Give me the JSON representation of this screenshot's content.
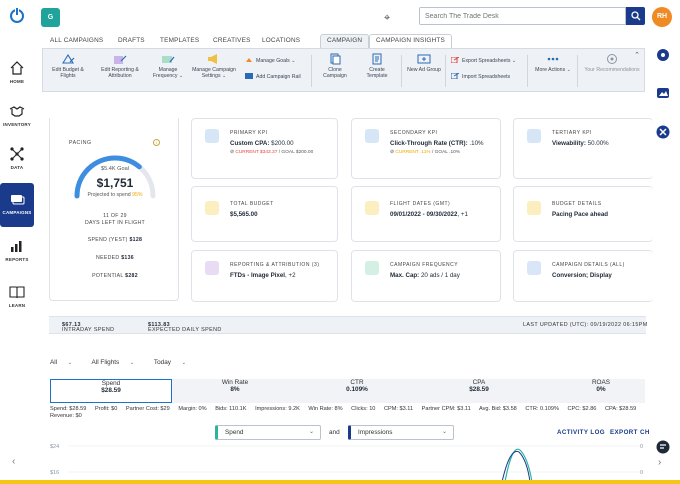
{
  "header": {
    "brand_initial": "G",
    "search_placeholder": "Search The Trade Desk",
    "avatar_initials": "RH"
  },
  "leftnav": {
    "items": [
      {
        "label": "HOME",
        "icon": "home-icon"
      },
      {
        "label": "INVENTORY",
        "icon": "handshake-icon"
      },
      {
        "label": "DATA",
        "icon": "network-icon"
      },
      {
        "label": "CAMPAIGNS",
        "icon": "campaigns-icon",
        "active": true
      },
      {
        "label": "REPORTS",
        "icon": "bar-chart-icon"
      },
      {
        "label": "LEARN",
        "icon": "book-icon"
      }
    ]
  },
  "tabs": [
    "ALL CAMPAIGNS",
    "DRAFTS",
    "TEMPLATES",
    "CREATIVES",
    "LOCATIONS",
    "CAMPAIGN",
    "CAMPAIGN INSIGHTS"
  ],
  "ribbon": {
    "edit_budget": "Edit Budget & Flights",
    "edit_reporting": "Edit Reporting & Attribution",
    "manage_frequency": "Manage Frequency",
    "manage_campaign_settings": "Manage Campaign Settings",
    "manage_goals": "Manage Goals",
    "add_campaign_rail": "Add Campaign Rail",
    "clone_campaign": "Clone Campaign",
    "create_template": "Create Template",
    "new_ad_group": "New Ad Group",
    "export_spreadsheets": "Export Spreadsheets",
    "import_spreadsheets": "Import Spreadsheets",
    "more_actions": "More Actions",
    "your_recommendations": "Your Recommendations"
  },
  "pacing": {
    "title": "PACING",
    "goal": "$5.4K Goal",
    "amount": "$1,751",
    "projected_label": "Projected to spend",
    "projected_pct": "95%",
    "fraction": 0.72,
    "days_line1": "11 OF 29",
    "days_line2": "DAYS LEFT IN FLIGHT",
    "spend_yest_label": "SPEND (YEST)",
    "spend_yest": "$128",
    "needed_label": "NEEDED",
    "needed": "$136",
    "potential_label": "POTENTIAL",
    "potential": "$282"
  },
  "kpis": [
    {
      "title": "PRIMARY KPI",
      "value_label": "Custom CPA:",
      "value": "$200.00",
      "sub_current": "CURRENT $343.37",
      "sub_goal": "/ GOAL $200.00",
      "icon": "hanger-icon"
    },
    {
      "title": "SECONDARY KPI",
      "value_label": "Click-Through Rate (CTR):",
      "value": ".10%",
      "sub_current": "CURRENT .11%",
      "sub_goal": "/ GOAL .10%",
      "icon": "hanger-icon"
    },
    {
      "title": "TERTIARY KPI",
      "value_label": "Viewability:",
      "value": "50.00%",
      "sub_current": "",
      "sub_goal": "",
      "icon": "hanger-icon"
    },
    {
      "title": "TOTAL BUDGET",
      "value": "$5,565.00",
      "icon": "scale-icon"
    },
    {
      "title": "FLIGHT DATES (GMT)",
      "value": "09/01/2022 - 09/30/2022",
      "extra": ", +1",
      "icon": "scale-icon"
    },
    {
      "title": "BUDGET DETAILS",
      "value": "Pacing Pace ahead",
      "icon": "scale-icon"
    },
    {
      "title": "REPORTING & ATTRIBUTION (3)",
      "value": "FTDs - Image Pixel",
      "extra": ", +2",
      "icon": "line-chart-icon"
    },
    {
      "title": "CAMPAIGN FREQUENCY",
      "value_label": "Max. Cap:",
      "value": "20 ads / 1 day",
      "icon": "frequency-icon"
    },
    {
      "title": "CAMPAIGN DETAILS (ALL)",
      "value": "Conversion; Display",
      "icon": "megaphone-icon"
    }
  ],
  "strip": {
    "intraday_label": "INTRADAY SPEND",
    "intraday": "$67.13",
    "expected_label": "EXPECTED DAILY SPEND",
    "expected": "$113.83",
    "updated": "LAST UPDATED (UTC): 09/19/2022 06:15PM"
  },
  "filters": {
    "all": "All",
    "flights": "All Flights",
    "range": "Today"
  },
  "metrics": [
    {
      "label": "Spend",
      "value": "$28.59"
    },
    {
      "label": "Win Rate",
      "value": "8%"
    },
    {
      "label": "CTR",
      "value": "0.109%"
    },
    {
      "label": "CPA",
      "value": "$28.59"
    },
    {
      "label": "ROAS",
      "value": "0%"
    }
  ],
  "details": [
    "Spend: $28.59",
    "Profit: $0",
    "Partner Cost: $29",
    "Margin: 0%",
    "Bids: 110.1K",
    "Impressions: 9.2K",
    "Win Rate: 8%",
    "Clicks: 10",
    "CPM: $3.11",
    "Partner CPM: $3.11",
    "Avg. Bid: $3.58",
    "CTR: 0.109%",
    "CPC: $2.86",
    "CPA: $28.59"
  ],
  "details2": "Revenue: $0",
  "chart_controls": {
    "metric1": "Spend",
    "and": "and",
    "metric2": "Impressions",
    "activity_log": "ACTIVITY LOG",
    "export": "EXPORT CH"
  },
  "mini_chart": {
    "y_labels": [
      "$24",
      "$16"
    ],
    "right_labels": [
      "0",
      "0"
    ]
  },
  "colors": {
    "navy": "#1a3a8c",
    "accent_blue": "#1a73c8",
    "pacing_yellow": "#f0a500",
    "alert_red": "#e0453a",
    "teal": "#2bb3a0",
    "avatar_orange": "#f08a24"
  }
}
